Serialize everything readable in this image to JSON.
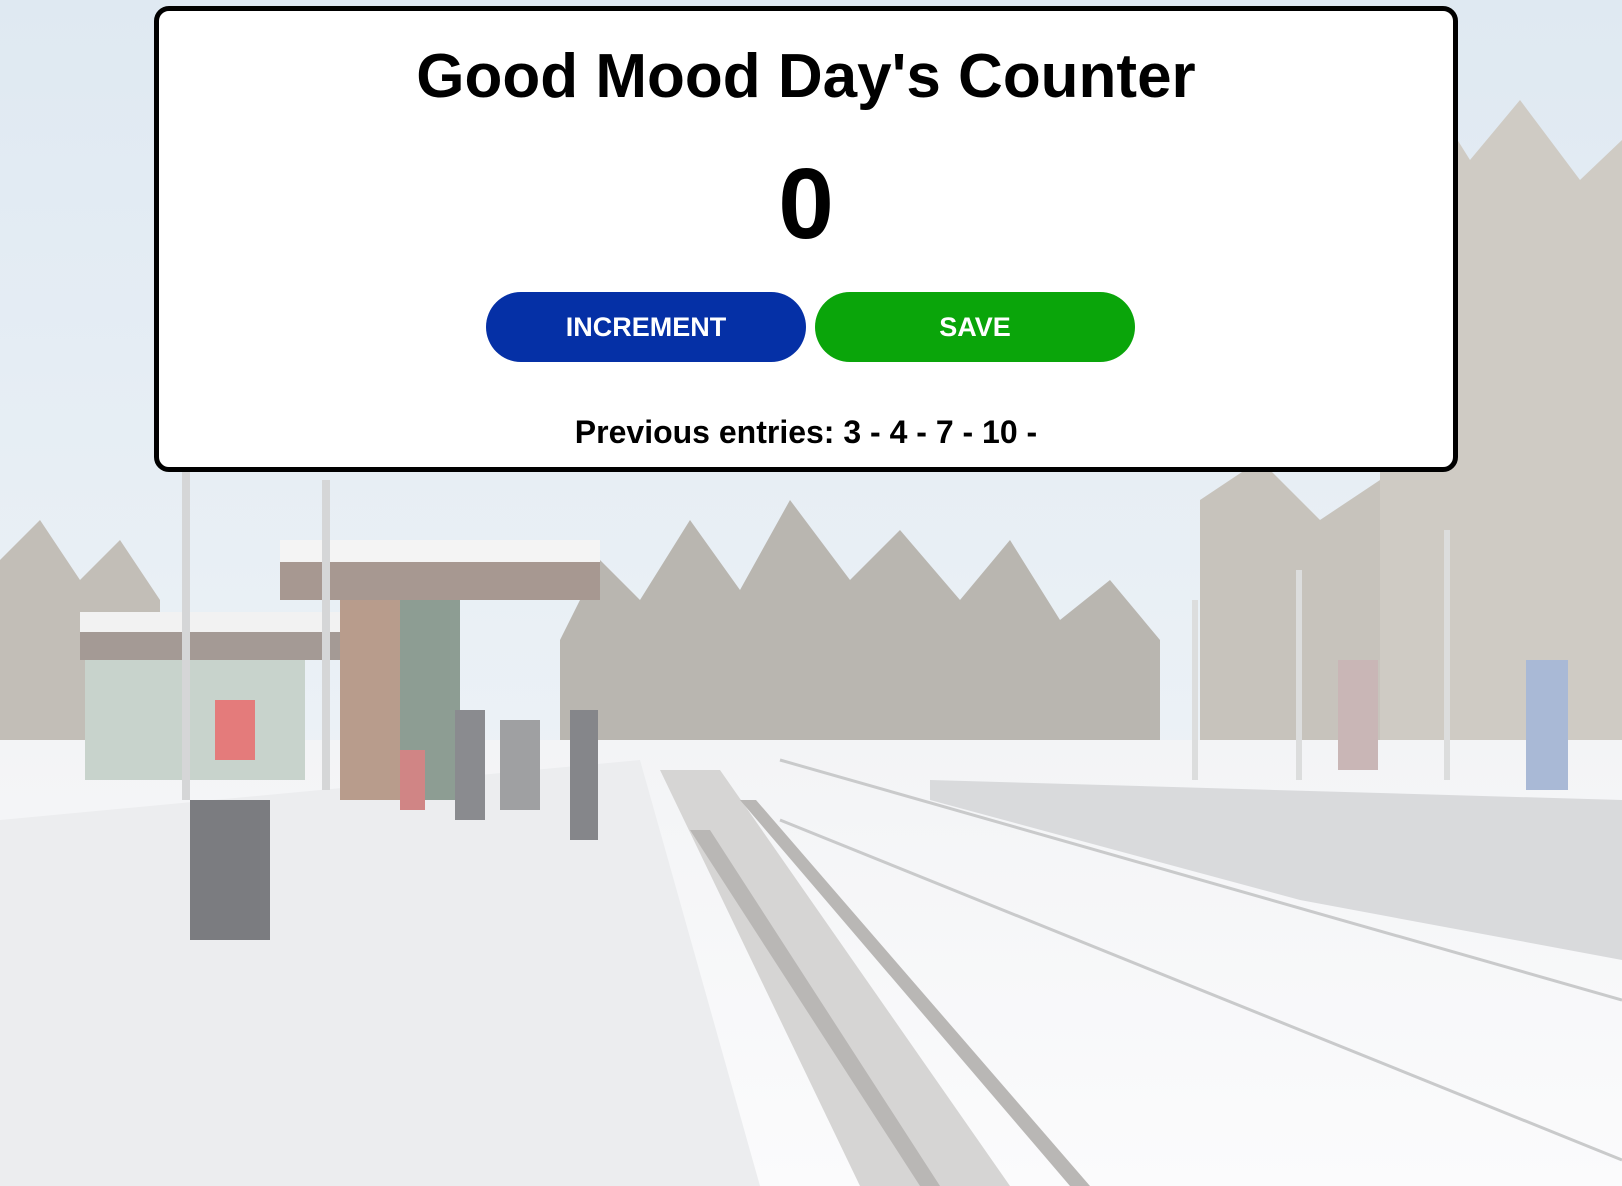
{
  "counter": {
    "title": "Good Mood Day's Counter",
    "value": "0",
    "increment_label": "INCREMENT",
    "save_label": "SAVE",
    "entries_label": "Previous entries:",
    "entries": [
      "3",
      "4",
      "7",
      "10"
    ],
    "entries_text": "Previous entries: 3 - 4 - 7 - 10 -"
  },
  "colors": {
    "increment_button": "#0530a6",
    "save_button": "#0aa50a",
    "card_border": "#000000",
    "card_background": "#ffffff"
  }
}
